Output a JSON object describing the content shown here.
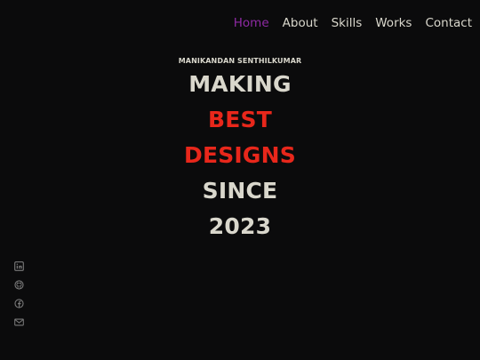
{
  "nav": {
    "items": [
      {
        "label": "Home",
        "active": true
      },
      {
        "label": "About",
        "active": false
      },
      {
        "label": "Skills",
        "active": false
      },
      {
        "label": "Works",
        "active": false
      },
      {
        "label": "Contact",
        "active": false
      }
    ]
  },
  "hero": {
    "name": "MANIKANDAN SENTHILKUMAR",
    "lines": [
      "MAKING",
      "BEST",
      "DESIGNS",
      "SINCE",
      "2023"
    ]
  },
  "social": {
    "icons": [
      "linkedin-icon",
      "github-icon",
      "facebook-icon",
      "mail-icon"
    ]
  },
  "colors": {
    "background": "#0b0b0c",
    "text": "#d9d7cc",
    "accent": "#e8271b",
    "active_nav": "#8e2aa3",
    "icon": "#7a7a7a"
  }
}
